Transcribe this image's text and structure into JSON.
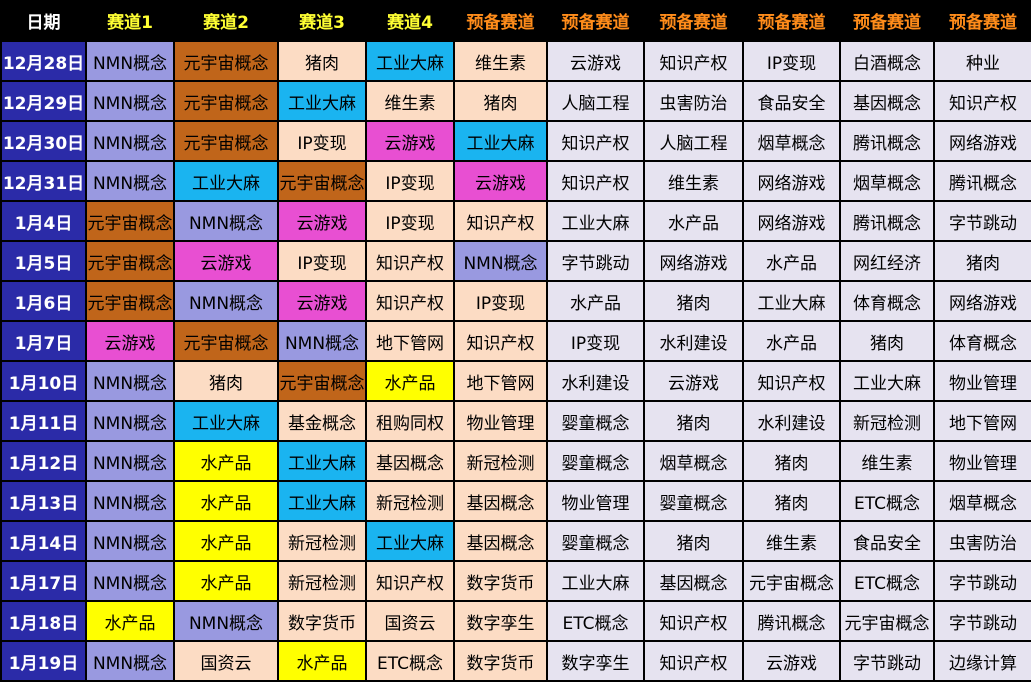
{
  "headers": [
    "日期",
    "赛道1",
    "赛道2",
    "赛道3",
    "赛道4",
    "预备赛道",
    "预备赛道",
    "预备赛道",
    "预备赛道",
    "预备赛道",
    "预备赛道"
  ],
  "colors": {
    "NMN概念": "#9999e0",
    "元宇宙概念": "#c0651a",
    "猪肉": "#fcdcc4",
    "工业大麻": "#1ab4f0",
    "维生素": "#fcdcc4",
    "IP变现": "#fcdcc4",
    "云游戏": "#e84fd2",
    "知识产权": "#fcdcc4",
    "地下管网": "#fcdcc4",
    "水产品": "#ffff00",
    "基金概念": "#fcdcc4",
    "租购同权": "#fcdcc4",
    "物业管理": "#fcdcc4",
    "基因概念": "#fcdcc4",
    "新冠检测": "#fcdcc4",
    "数字货币": "#fcdcc4",
    "国资云": "#fcdcc4",
    "数字孪生": "#fcdcc4",
    "ETC概念": "#fcdcc4"
  },
  "rows": [
    {
      "date": "12月28日",
      "lanes": [
        "NMN概念",
        "元宇宙概念",
        "猪肉",
        "工业大麻",
        "维生素"
      ],
      "reserve": [
        "云游戏",
        "知识产权",
        "IP变现",
        "白酒概念",
        "种业"
      ]
    },
    {
      "date": "12月29日",
      "lanes": [
        "NMN概念",
        "元宇宙概念",
        "工业大麻",
        "维生素",
        "猪肉"
      ],
      "reserve": [
        "人脑工程",
        "虫害防治",
        "食品安全",
        "基因概念",
        "知识产权"
      ]
    },
    {
      "date": "12月30日",
      "lanes": [
        "NMN概念",
        "元宇宙概念",
        "IP变现",
        "云游戏",
        "工业大麻"
      ],
      "reserve": [
        "知识产权",
        "人脑工程",
        "烟草概念",
        "腾讯概念",
        "网络游戏"
      ]
    },
    {
      "date": "12月31日",
      "lanes": [
        "NMN概念",
        "工业大麻",
        "元宇宙概念",
        "IP变现",
        "云游戏"
      ],
      "reserve": [
        "知识产权",
        "维生素",
        "网络游戏",
        "烟草概念",
        "腾讯概念"
      ]
    },
    {
      "date": "1月4日",
      "lanes": [
        "元宇宙概念",
        "NMN概念",
        "云游戏",
        "IP变现",
        "知识产权"
      ],
      "reserve": [
        "工业大麻",
        "水产品",
        "网络游戏",
        "腾讯概念",
        "字节跳动"
      ]
    },
    {
      "date": "1月5日",
      "lanes": [
        "元宇宙概念",
        "云游戏",
        "IP变现",
        "知识产权",
        "NMN概念"
      ],
      "reserve": [
        "字节跳动",
        "网络游戏",
        "水产品",
        "网红经济",
        "猪肉"
      ]
    },
    {
      "date": "1月6日",
      "lanes": [
        "元宇宙概念",
        "NMN概念",
        "云游戏",
        "知识产权",
        "IP变现"
      ],
      "reserve": [
        "水产品",
        "猪肉",
        "工业大麻",
        "体育概念",
        "网络游戏"
      ]
    },
    {
      "date": "1月7日",
      "lanes": [
        "云游戏",
        "元宇宙概念",
        "NMN概念",
        "地下管网",
        "知识产权"
      ],
      "reserve": [
        "IP变现",
        "水利建设",
        "水产品",
        "猪肉",
        "体育概念"
      ]
    },
    {
      "date": "1月10日",
      "lanes": [
        "NMN概念",
        "猪肉",
        "元宇宙概念",
        "水产品",
        "地下管网"
      ],
      "reserve": [
        "水利建设",
        "云游戏",
        "知识产权",
        "工业大麻",
        "物业管理"
      ]
    },
    {
      "date": "1月11日",
      "lanes": [
        "NMN概念",
        "工业大麻",
        "基金概念",
        "租购同权",
        "物业管理"
      ],
      "reserve": [
        "婴童概念",
        "猪肉",
        "水利建设",
        "新冠检测",
        "地下管网"
      ]
    },
    {
      "date": "1月12日",
      "lanes": [
        "NMN概念",
        "水产品",
        "工业大麻",
        "基因概念",
        "新冠检测"
      ],
      "reserve": [
        "婴童概念",
        "烟草概念",
        "猪肉",
        "维生素",
        "物业管理"
      ]
    },
    {
      "date": "1月13日",
      "lanes": [
        "NMN概念",
        "水产品",
        "工业大麻",
        "新冠检测",
        "基因概念"
      ],
      "reserve": [
        "物业管理",
        "婴童概念",
        "猪肉",
        "ETC概念",
        "烟草概念"
      ]
    },
    {
      "date": "1月14日",
      "lanes": [
        "NMN概念",
        "水产品",
        "新冠检测",
        "工业大麻",
        "基因概念"
      ],
      "reserve": [
        "婴童概念",
        "猪肉",
        "维生素",
        "食品安全",
        "虫害防治"
      ]
    },
    {
      "date": "1月17日",
      "lanes": [
        "NMN概念",
        "水产品",
        "新冠检测",
        "知识产权",
        "数字货币"
      ],
      "reserve": [
        "工业大麻",
        "基因概念",
        "元宇宙概念",
        "ETC概念",
        "字节跳动"
      ]
    },
    {
      "date": "1月18日",
      "lanes": [
        "水产品",
        "NMN概念",
        "数字货币",
        "国资云",
        "数字孪生"
      ],
      "reserve": [
        "ETC概念",
        "知识产权",
        "腾讯概念",
        "元宇宙概念",
        "字节跳动"
      ]
    },
    {
      "date": "1月19日",
      "lanes": [
        "NMN概念",
        "国资云",
        "水产品",
        "ETC概念",
        "数字货币"
      ],
      "reserve": [
        "数字孪生",
        "知识产权",
        "云游戏",
        "字节跳动",
        "边缘计算"
      ]
    }
  ]
}
